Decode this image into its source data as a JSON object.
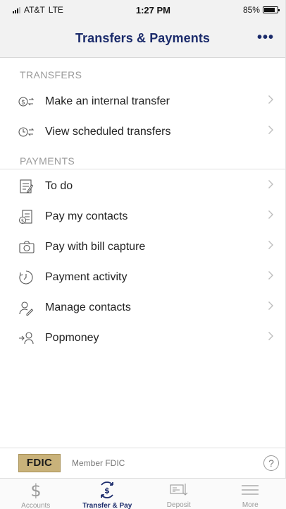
{
  "status_bar": {
    "carrier": "AT&T",
    "network": "LTE",
    "time": "1:27 PM",
    "battery": "85%",
    "battery_level": 0.85
  },
  "nav": {
    "title": "Transfers & Payments",
    "more_label": "•••"
  },
  "transfers": {
    "header": "TRANSFERS",
    "items": [
      {
        "label": "Make an internal transfer",
        "icon": "internal-transfer-icon"
      },
      {
        "label": "View scheduled transfers",
        "icon": "scheduled-transfer-icon"
      }
    ]
  },
  "payments": {
    "header": "PAYMENTS",
    "items": [
      {
        "label": "To do",
        "icon": "to-do-icon"
      },
      {
        "label": "Pay my contacts",
        "icon": "pay-contacts-icon"
      },
      {
        "label": "Pay with bill capture",
        "icon": "camera-icon"
      },
      {
        "label": "Payment activity",
        "icon": "payment-activity-icon"
      },
      {
        "label": "Manage contacts",
        "icon": "manage-contacts-icon"
      },
      {
        "label": "Popmoney",
        "icon": "popmoney-icon"
      }
    ]
  },
  "footer": {
    "fdic_logo": "FDIC",
    "fdic_text": "Member FDIC",
    "help": "?"
  },
  "tabs": [
    {
      "label": "Accounts",
      "icon": "dollar-icon",
      "active": false
    },
    {
      "label": "Transfer & Pay",
      "icon": "transfer-pay-icon",
      "active": true
    },
    {
      "label": "Deposit",
      "icon": "deposit-check-icon",
      "active": false
    },
    {
      "label": "More",
      "icon": "menu-icon",
      "active": false
    }
  ],
  "colors": {
    "accent": "#1b2b6b",
    "section_header": "#9a9a9a",
    "fdic_gold": "#c9b27a"
  }
}
